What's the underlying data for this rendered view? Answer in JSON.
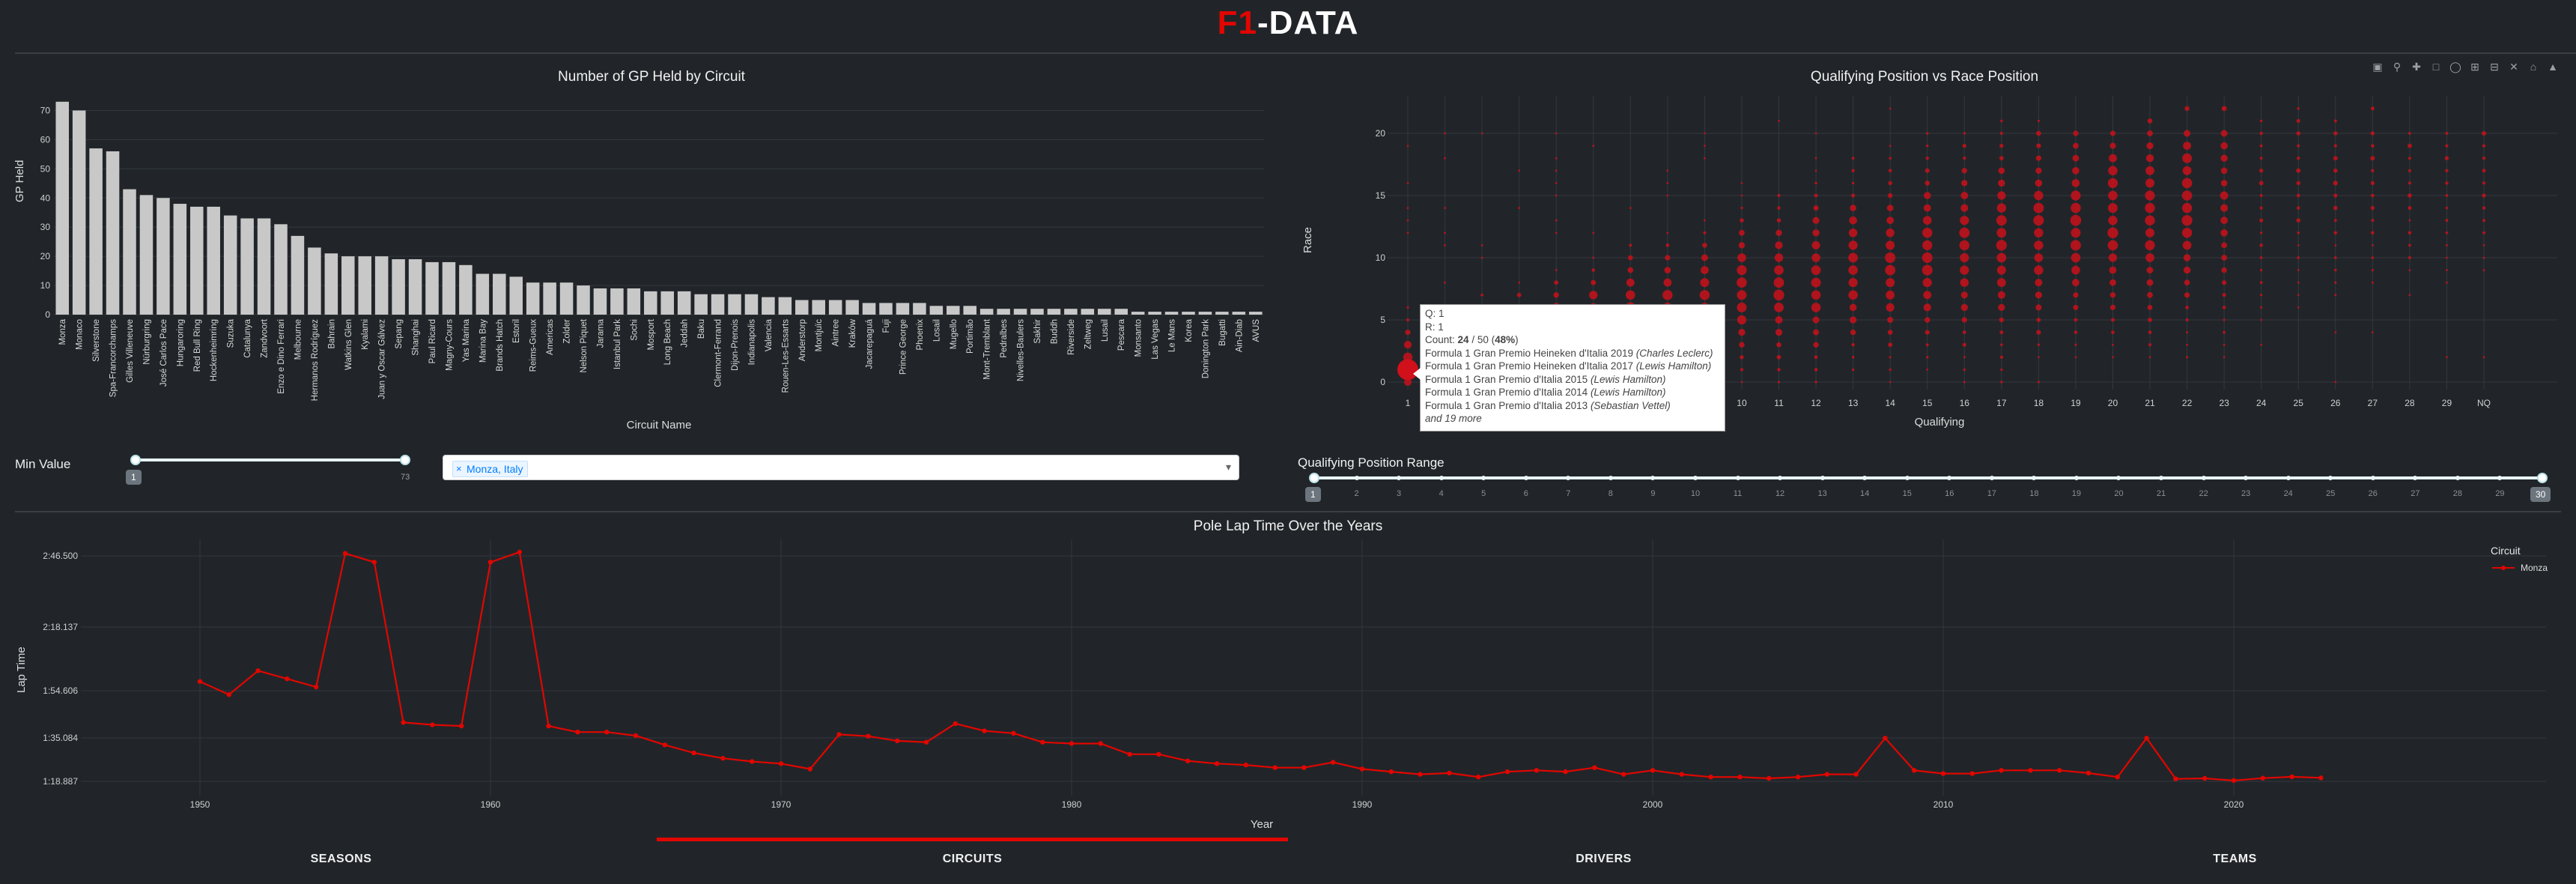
{
  "app": {
    "title_red": "F1",
    "title_rest": "-DATA"
  },
  "gp_chart": {
    "title": "Number of GP Held by Circuit",
    "xlabel": "Circuit Name",
    "ylabel": "GP Held",
    "yticks": [
      "0",
      "10",
      "20",
      "30",
      "40",
      "50",
      "60",
      "70"
    ]
  },
  "scatter_chart": {
    "title": "Qualifying Position vs Race Position",
    "xlabel": "Qualifying",
    "ylabel": "Race",
    "xticks": [
      "1",
      "2",
      "3",
      "4",
      "5",
      "6",
      "7",
      "8",
      "9",
      "10",
      "11",
      "12",
      "13",
      "14",
      "15",
      "16",
      "17",
      "18",
      "19",
      "20",
      "21",
      "22",
      "23",
      "24",
      "25",
      "26",
      "27",
      "28",
      "29",
      "NQ"
    ],
    "yticks": [
      "0",
      "5",
      "10",
      "15",
      "20"
    ]
  },
  "tooltip": {
    "q_line": "Q: 1",
    "r_line": "R: 1",
    "count_prefix": "Count: ",
    "count_value": "24",
    "count_mid": " / 50 (",
    "count_pct": "48%",
    "count_suffix": ")",
    "races": [
      {
        "race": "Formula 1 Gran Premio Heineken d'Italia 2019 ",
        "driver": "(Charles Leclerc)"
      },
      {
        "race": "Formula 1 Gran Premio Heineken d'Italia 2017 ",
        "driver": "(Lewis Hamilton)"
      },
      {
        "race": "Formula 1 Gran Premio d'Italia 2015 ",
        "driver": "(Lewis Hamilton)"
      },
      {
        "race": "Formula 1 Gran Premio d'Italia 2014 ",
        "driver": "(Lewis Hamilton)"
      },
      {
        "race": "Formula 1 Gran Premio d'Italia 2013 ",
        "driver": "(Sebastian Vettel)"
      }
    ],
    "more": "and 19 more"
  },
  "controls": {
    "min_value_label": "Min Value",
    "min_value_low": "1",
    "min_value_high": "73",
    "circuit_select_value": "Monza, Italy",
    "qual_range_label": "Qualifying Position Range",
    "qual_range_low": "1",
    "qual_range_high": "30",
    "qual_range_ticks": [
      "1",
      "2",
      "3",
      "4",
      "5",
      "6",
      "7",
      "8",
      "9",
      "10",
      "11",
      "12",
      "13",
      "14",
      "15",
      "16",
      "17",
      "18",
      "19",
      "20",
      "21",
      "22",
      "23",
      "24",
      "25",
      "26",
      "27",
      "28",
      "29",
      "30"
    ]
  },
  "lap_chart": {
    "title": "Pole Lap Time Over the Years",
    "xlabel": "Year",
    "ylabel": "Lap Time",
    "legend_title": "Circuit",
    "yticks": [
      "1:18.887",
      "1:35.084",
      "1:54.606",
      "2:18.137",
      "2:46.500"
    ],
    "xticks": [
      "1950",
      "1960",
      "1970",
      "1980",
      "1990",
      "2000",
      "2010",
      "2020"
    ]
  },
  "tabs": [
    {
      "label": "SEASONS",
      "active": false
    },
    {
      "label": "CIRCUITS",
      "active": true
    },
    {
      "label": "DRIVERS",
      "active": false
    },
    {
      "label": "TEAMS",
      "active": false
    }
  ],
  "colors": {
    "accent": "#e10600",
    "bars": "#c8c8c8",
    "background": "#212529"
  },
  "chart_data": [
    {
      "type": "bar",
      "title": "Number of GP Held by Circuit",
      "xlabel": "Circuit Name",
      "ylabel": "GP Held",
      "ylim": [
        0,
        75
      ],
      "categories": [
        "Monza",
        "Monaco",
        "Silverstone",
        "Spa-Francorchamps",
        "Gilles Villeneuve",
        "Nürburgring",
        "José Carlos Pace",
        "Hungaroring",
        "Red Bull Ring",
        "Hockenheimring",
        "Suzuka",
        "Catalunya",
        "Zandvoort",
        "Enzo e Dino Ferrari",
        "Melbourne",
        "Hermanos Rodríguez",
        "Bahrain",
        "Watkins Glen",
        "Kyalami",
        "Juan y Oscar Gálvez",
        "Sepang",
        "Shanghai",
        "Paul Ricard",
        "Magny-Cours",
        "Yas Marina",
        "Marina Bay",
        "Brands Hatch",
        "Estoril",
        "Reims-Gueux",
        "Americas",
        "Zolder",
        "Nelson Piquet",
        "Jarama",
        "Istanbul Park",
        "Sochi",
        "Mosport",
        "Long Beach",
        "Jeddah",
        "Baku",
        "Clermont-Ferrand",
        "Dijon-Prenois",
        "Indianapolis",
        "Valencia",
        "Rouen-Les-Essarts",
        "Anderstorp",
        "Montjuïc",
        "Aintree",
        "Kraków",
        "Jacarepaguá",
        "Fuji",
        "Prince George",
        "Phoenix",
        "Losail",
        "Mugello",
        "Portimão",
        "Mont-Tremblant",
        "Pedralbes",
        "Nivelles-Baulers",
        "Sakhir",
        "Buddh",
        "Riverside",
        "Zeltweg",
        "Lusail",
        "Pescara",
        "Monsanto",
        "Las Vegas",
        "Le Mans",
        "Korea",
        "Donington Park",
        "Bugatti",
        "Ain-Diab",
        "AVUS"
      ],
      "values": [
        73,
        70,
        57,
        56,
        43,
        41,
        40,
        38,
        37,
        37,
        34,
        33,
        33,
        31,
        27,
        23,
        21,
        20,
        20,
        20,
        19,
        19,
        18,
        18,
        17,
        14,
        14,
        13,
        11,
        11,
        11,
        10,
        9,
        9,
        9,
        8,
        8,
        8,
        7,
        7,
        7,
        7,
        6,
        6,
        5,
        5,
        5,
        5,
        4,
        4,
        4,
        4,
        3,
        3,
        3,
        2,
        2,
        2,
        2,
        2,
        2,
        2,
        2,
        2,
        1,
        1,
        1,
        1,
        1,
        1,
        1,
        1
      ]
    },
    {
      "type": "scatter",
      "title": "Qualifying Position vs Race Position",
      "xlabel": "Qualifying",
      "ylabel": "Race",
      "ylim": [
        -1,
        23
      ],
      "note": "bubble size = count; highlighted point Q:1 R:1 count 24 of 50",
      "highlight": {
        "q": 1,
        "r": 1,
        "count": 24,
        "total": 50
      }
    },
    {
      "type": "line",
      "title": "Pole Lap Time Over the Years",
      "xlabel": "Year",
      "ylabel": "Lap Time",
      "series": [
        {
          "name": "Monza",
          "x": [
            1950,
            1951,
            1952,
            1953,
            1954,
            1955,
            1956,
            1957,
            1958,
            1959,
            1960,
            1961,
            1962,
            1963,
            1964,
            1965,
            1966,
            1967,
            1968,
            1969,
            1970,
            1971,
            1972,
            1973,
            1974,
            1975,
            1976,
            1977,
            1978,
            1979,
            1980,
            1981,
            1982,
            1983,
            1984,
            1985,
            1986,
            1987,
            1988,
            1989,
            1990,
            1991,
            1992,
            1993,
            1994,
            1995,
            1996,
            1997,
            1998,
            1999,
            2000,
            2001,
            2002,
            2003,
            2004,
            2005,
            2006,
            2007,
            2008,
            2009,
            2010,
            2011,
            2012,
            2013,
            2014,
            2015,
            2016,
            2017,
            2018,
            2019,
            2020,
            2021,
            2022,
            2023
          ],
          "y_seconds": [
            118.0,
            113.0,
            122.0,
            119.0,
            116.0,
            167.5,
            164.0,
            101.5,
            100.5,
            100.0,
            164.0,
            168.0,
            100.0,
            97.5,
            97.5,
            96.0,
            92.5,
            89.5,
            87.5,
            86.3,
            85.5,
            83.5,
            96.5,
            95.8,
            94.0,
            93.5,
            101.0,
            98.0,
            97.0,
            93.5,
            93.0,
            93.0,
            89.0,
            89.0,
            86.5,
            85.5,
            85.0,
            84.0,
            84.0,
            86.0,
            83.5,
            82.5,
            81.5,
            82.0,
            80.5,
            82.5,
            83.0,
            82.5,
            84.0,
            81.5,
            83.0,
            81.5,
            80.5,
            80.5,
            80.0,
            80.5,
            81.5,
            81.5,
            95.0,
            83.0,
            81.8,
            81.8,
            83.0,
            83.0,
            83.0,
            82.0,
            80.5,
            95.0,
            79.8,
            80.0,
            79.2,
            80.1,
            80.6,
            80.2
          ]
        }
      ]
    }
  ]
}
